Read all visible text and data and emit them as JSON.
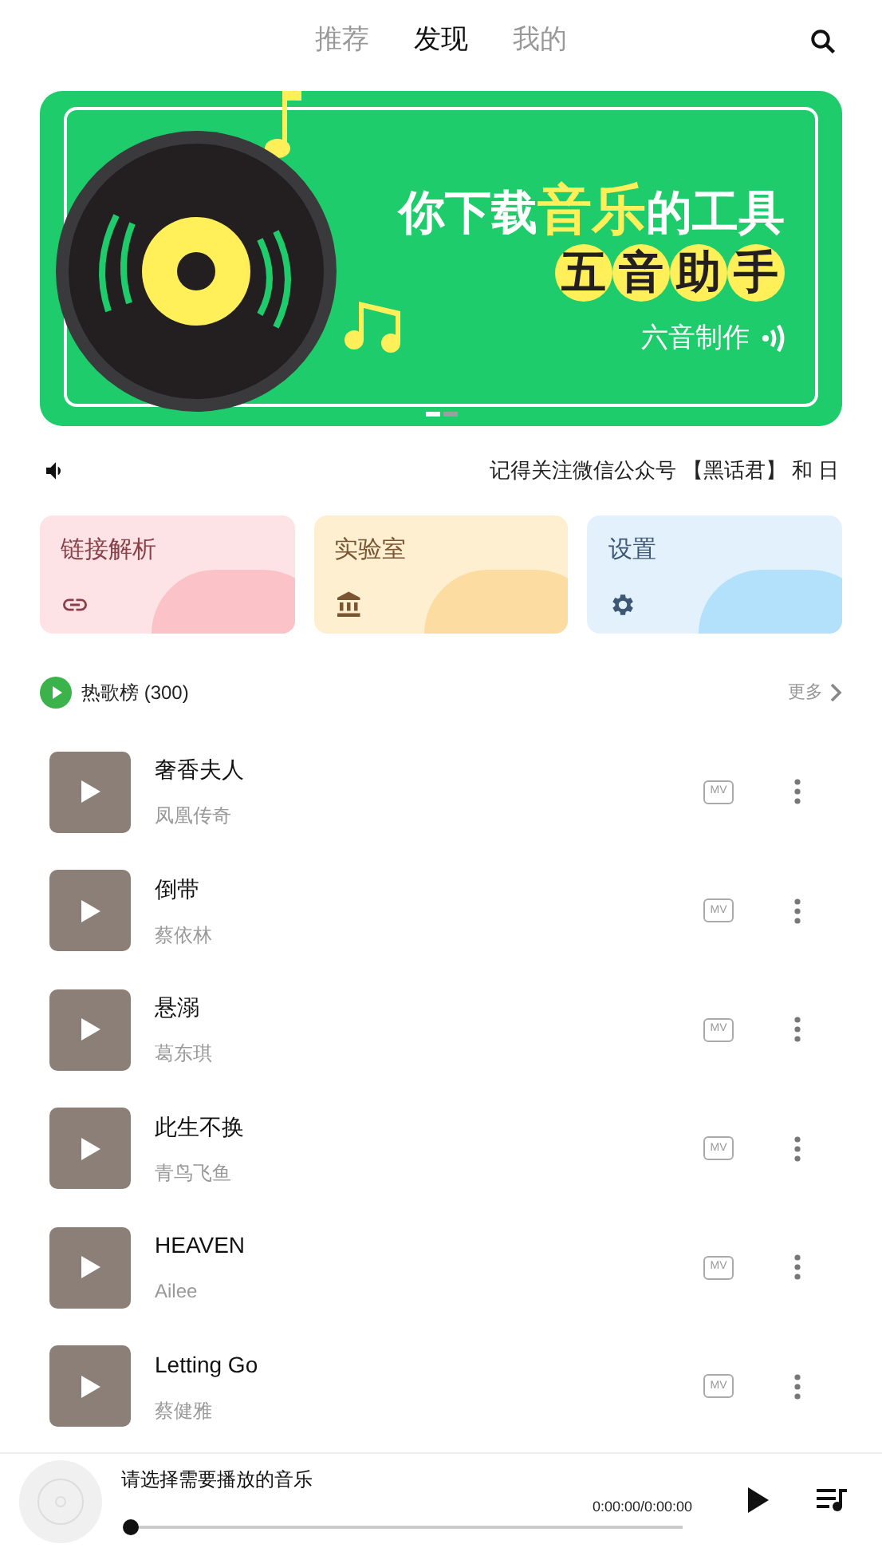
{
  "tabs": [
    {
      "label": "推荐",
      "selected": false
    },
    {
      "label": "发现",
      "selected": true
    },
    {
      "label": "我的",
      "selected": false
    }
  ],
  "banner": {
    "headline_start": "你下载",
    "headline_highlight": "音乐",
    "headline_end": "的工具",
    "app_name": [
      "五",
      "音",
      "助",
      "手"
    ],
    "maker": "六音制作",
    "page_dots": [
      {
        "selected": true
      },
      {
        "selected": false
      }
    ]
  },
  "notice": "记得关注微信公众号 【黑话君】 和 日",
  "shortcuts": [
    {
      "label": "链接解析",
      "kind": "link"
    },
    {
      "label": "实验室",
      "kind": "lab"
    },
    {
      "label": "设置",
      "kind": "settings"
    }
  ],
  "chart_section": {
    "title": "热歌榜 (300)",
    "more": "更多"
  },
  "songs": [
    {
      "title": "奢香夫人",
      "artist": "凤凰传奇",
      "mv": "MV"
    },
    {
      "title": "倒带",
      "artist": "蔡依林",
      "mv": "MV"
    },
    {
      "title": "悬溺",
      "artist": "葛东琪",
      "mv": "MV"
    },
    {
      "title": "此生不换",
      "artist": "青鸟飞鱼",
      "mv": "MV"
    },
    {
      "title": "HEAVEN",
      "artist": "Ailee",
      "mv": "MV"
    },
    {
      "title": "Letting Go",
      "artist": "蔡健雅",
      "mv": "MV"
    }
  ],
  "player": {
    "prompt": "请选择需要播放的音乐",
    "time": "0:00:00/0:00:00",
    "level": 0
  }
}
